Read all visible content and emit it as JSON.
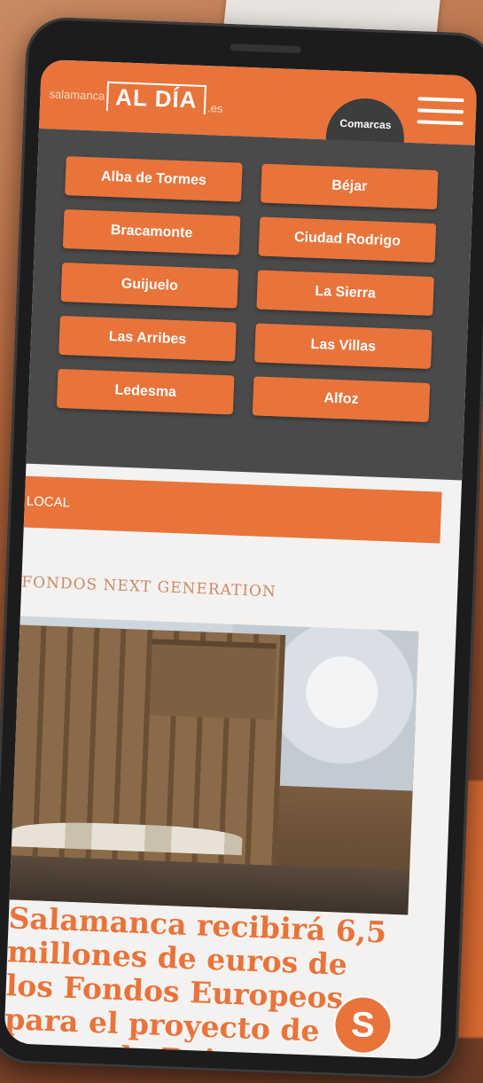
{
  "header": {
    "logo_pre": "salamanca",
    "logo_main": "AL DÍA",
    "logo_post": ".es",
    "comarcas_label": "Comarcas"
  },
  "comarcas": [
    "Alba de Tormes",
    "Béjar",
    "Bracamonte",
    "Ciudad Rodrigo",
    "Guijuelo",
    "La Sierra",
    "Las Arribes",
    "Las Villas",
    "Ledesma",
    "Alfoz"
  ],
  "section": {
    "label": "LOCAL"
  },
  "article": {
    "kicker": "FONDOS NEXT GENERATION",
    "headline": "Salamanca recibirá 6,5 millones de euros de los Fondos Europeos para el proyecto de Zonas de Bajas Emisiones"
  },
  "badge": {
    "letter": "S"
  },
  "colors": {
    "accent": "#e8743b",
    "menu_bg": "#4a4a4a"
  }
}
